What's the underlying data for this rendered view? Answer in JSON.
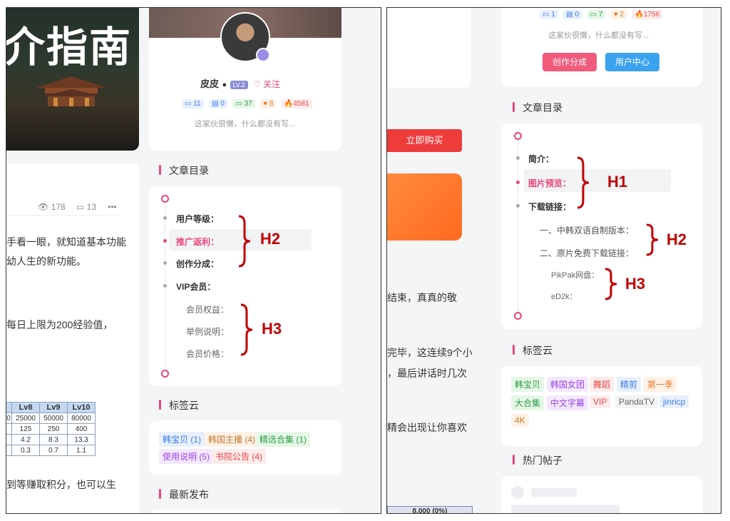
{
  "left": {
    "hero_title": "介指南",
    "author": {
      "name": "皮皮",
      "level": "LV.2",
      "follow": "关注",
      "stats": [
        "11",
        "0",
        "37",
        "8",
        "4581"
      ],
      "bio": "这家伙很懒，什么都没有写..."
    },
    "views": "178",
    "comments": "13",
    "more": "•••",
    "paragraphs": [
      "手看一眼，就知道基本功能",
      "幼人生的新功能。",
      "每日上限为200经验值，",
      "到等赚取积分，也可以生"
    ],
    "table": {
      "headers": [
        "Lv8",
        "Lv9",
        "Lv10"
      ],
      "rows": [
        [
          "0",
          "25000",
          "50000",
          "80000"
        ],
        [
          "",
          "125",
          "250",
          "400"
        ],
        [
          "",
          "4.2",
          "8.3",
          "13.3"
        ],
        [
          "",
          "0.3",
          "0.7",
          "1.1"
        ]
      ]
    },
    "toc_title": "文章目录",
    "toc": [
      "用户等级：",
      "推广返利：",
      "创作分成：",
      "VIP会员：",
      "会员权益：",
      "举例说明：",
      "会员价格："
    ],
    "ann_h2": "H2",
    "ann_h3": "H3",
    "tags_title": "标签云",
    "tags": [
      "韩宝贝 (1)",
      "韩国主播 (4)",
      "精选合集 (1)",
      "使用说明 (5)",
      "书院公告 (4)"
    ],
    "latest_title": "最新发布"
  },
  "right": {
    "stats": [
      "1",
      "0",
      "7",
      "2",
      "1756"
    ],
    "bio": "这家伙很懒，什么都没有写...",
    "btn_create": "创作分成",
    "btn_user": "用户中心",
    "buy": "立即购买",
    "toc_title": "文章目录",
    "toc": [
      "简介：",
      "图片预览：",
      "下载链接：",
      "一、中韩双语自制版本：",
      "二、原片免费下载链接：",
      "PikPak网盘：",
      "eD2k："
    ],
    "ann_h1": "H1",
    "ann_h2": "H2",
    "ann_h3": "H3",
    "paragraphs": [
      "结束，真真的敬",
      "完毕，这连续9个小",
      "，最后讲话时几次",
      "精会出现让你喜欢"
    ],
    "bottom_text": "8,000 (0%)",
    "tags_title": "标签云",
    "tags": [
      "韩宝贝",
      "韩国女团",
      "舞蹈",
      "精剪",
      "第一季",
      "大合集",
      "中文字幕",
      "VIP",
      "PandaTV",
      "jinricp",
      "4K"
    ],
    "hot_title": "热门帖子"
  }
}
